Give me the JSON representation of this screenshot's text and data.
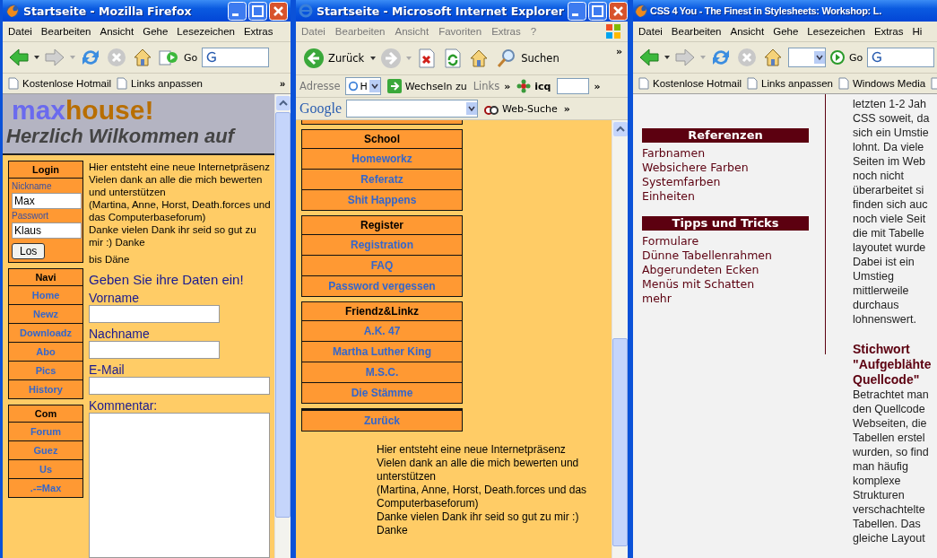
{
  "firefox_window": {
    "title": "Startseite - Mozilla Firefox",
    "menu": [
      "Datei",
      "Bearbeiten",
      "Ansicht",
      "Gehe",
      "Lesezeichen",
      "Extras"
    ],
    "go": "Go",
    "bookmarks": [
      "Kostenlose Hotmail",
      "Links anpassen"
    ],
    "more": "»",
    "page": {
      "logo_first": "max",
      "logo_second": "house!",
      "welcome": "Herzlich Wilkommen auf",
      "login": {
        "title": "Login",
        "fields": [
          {
            "label": "Nickname",
            "value": "Max"
          },
          {
            "label": "Passwort",
            "value": "Klaus"
          }
        ],
        "button": "Los"
      },
      "menus": [
        {
          "title": "Navi",
          "items": [
            "Home",
            "Newz",
            "Downloadz",
            "Abo",
            "Pics",
            "History"
          ]
        },
        {
          "title": "Com",
          "items": [
            "Forum",
            "Guez",
            "Us",
            ".-=Max"
          ]
        }
      ],
      "intro": [
        "Hier entsteht eine neue Internetpräsenz",
        "Vielen dank an alle die mich bewerten und unterstützen",
        "(Martina, Anne, Horst, Death.forces und das Computerbaseforum)",
        "Danke vielen Dank ihr seid so gut zu mir :) Danke"
      ],
      "signature": "bis Däne",
      "form_title": "Geben Sie ihre Daten ein!",
      "form_fields": [
        {
          "label": "Vorname",
          "kind": "short"
        },
        {
          "label": "Nachname",
          "kind": "short"
        },
        {
          "label": "E-Mail",
          "kind": "wide"
        },
        {
          "label": "Kommentar:",
          "kind": "area"
        }
      ]
    }
  },
  "ie_window": {
    "title": "Startseite - Microsoft Internet Explorer",
    "menu": [
      "Datei",
      "Bearbeiten",
      "Ansicht",
      "Favoriten",
      "Extras",
      "?"
    ],
    "back": "Zurück",
    "search": "Suchen",
    "more": "»",
    "address_label": "Adresse",
    "address_value": "H",
    "go": "Wechseln zu",
    "links": "Links",
    "icq": "icq",
    "google_logo": "Google",
    "web_search": "Web-Suche",
    "page": {
      "menus": [
        {
          "title": "School",
          "items": [
            "Homeworkz",
            "Referatz",
            "Shit Happens"
          ]
        },
        {
          "title": "Register",
          "items": [
            "Registration",
            "FAQ",
            "Password vergessen"
          ]
        },
        {
          "title": "Friendz&Linkz",
          "items": [
            "A.K. 47",
            "Martha Luther King",
            "M.S.C.",
            "Die Stämme"
          ]
        }
      ],
      "back_link": "Zurück",
      "intro": [
        "Hier entsteht eine neue Internetpräsenz",
        "Vielen dank an alle die mich bewerten und unterstützen",
        "(Martina, Anne, Horst, Death.forces und das Computerbaseforum)",
        "Danke vielen Dank ihr seid so gut zu mir :)",
        "Danke"
      ]
    }
  },
  "css_window": {
    "title": "CSS 4 You - The Finest in Stylesheets: Workshop: L.",
    "menu": [
      "Datei",
      "Bearbeiten",
      "Ansicht",
      "Gehe",
      "Lesezeichen",
      "Extras",
      "Hi"
    ],
    "go": "Go",
    "bookmarks": [
      "Kostenlose Hotmail",
      "Links anpassen",
      "Windows Media"
    ],
    "page": {
      "sections": [
        {
          "title": "Referenzen",
          "links": [
            "Farbnamen",
            "Websichere Farben",
            "Systemfarben",
            "Einheiten"
          ]
        },
        {
          "title": "Tipps und Tricks",
          "links": [
            "Formulare",
            "Dünne Tabellenrahmen",
            "Abgerundeten Ecken",
            "Menüs mit Schatten",
            "mehr"
          ]
        }
      ],
      "lines_top": [
        "letzten 1-2 Jah",
        "CSS soweit, da",
        "sich ein Umstie",
        "lohnt. Da viele",
        "Seiten im Web",
        "noch nicht",
        "überarbeitet si",
        "finden sich auc",
        "noch viele Seit",
        "die mit Tabelle",
        "layoutet wurde",
        "Dabei ist ein",
        "Umstieg",
        "mittlerweile",
        "durchaus",
        "lohnenswert."
      ],
      "heading_lines": [
        "Stichwort",
        "\"Aufgeblähte",
        "Quellcode\""
      ],
      "lines_bottom": [
        "Betrachtet man",
        "den Quellcode",
        "Webseiten, die",
        "Tabellen erstel",
        "wurden, so find",
        "man häufig",
        "komplexe",
        "Strukturen",
        "verschachtelte",
        "Tabellen. Das",
        "gleiche Layout"
      ]
    }
  }
}
